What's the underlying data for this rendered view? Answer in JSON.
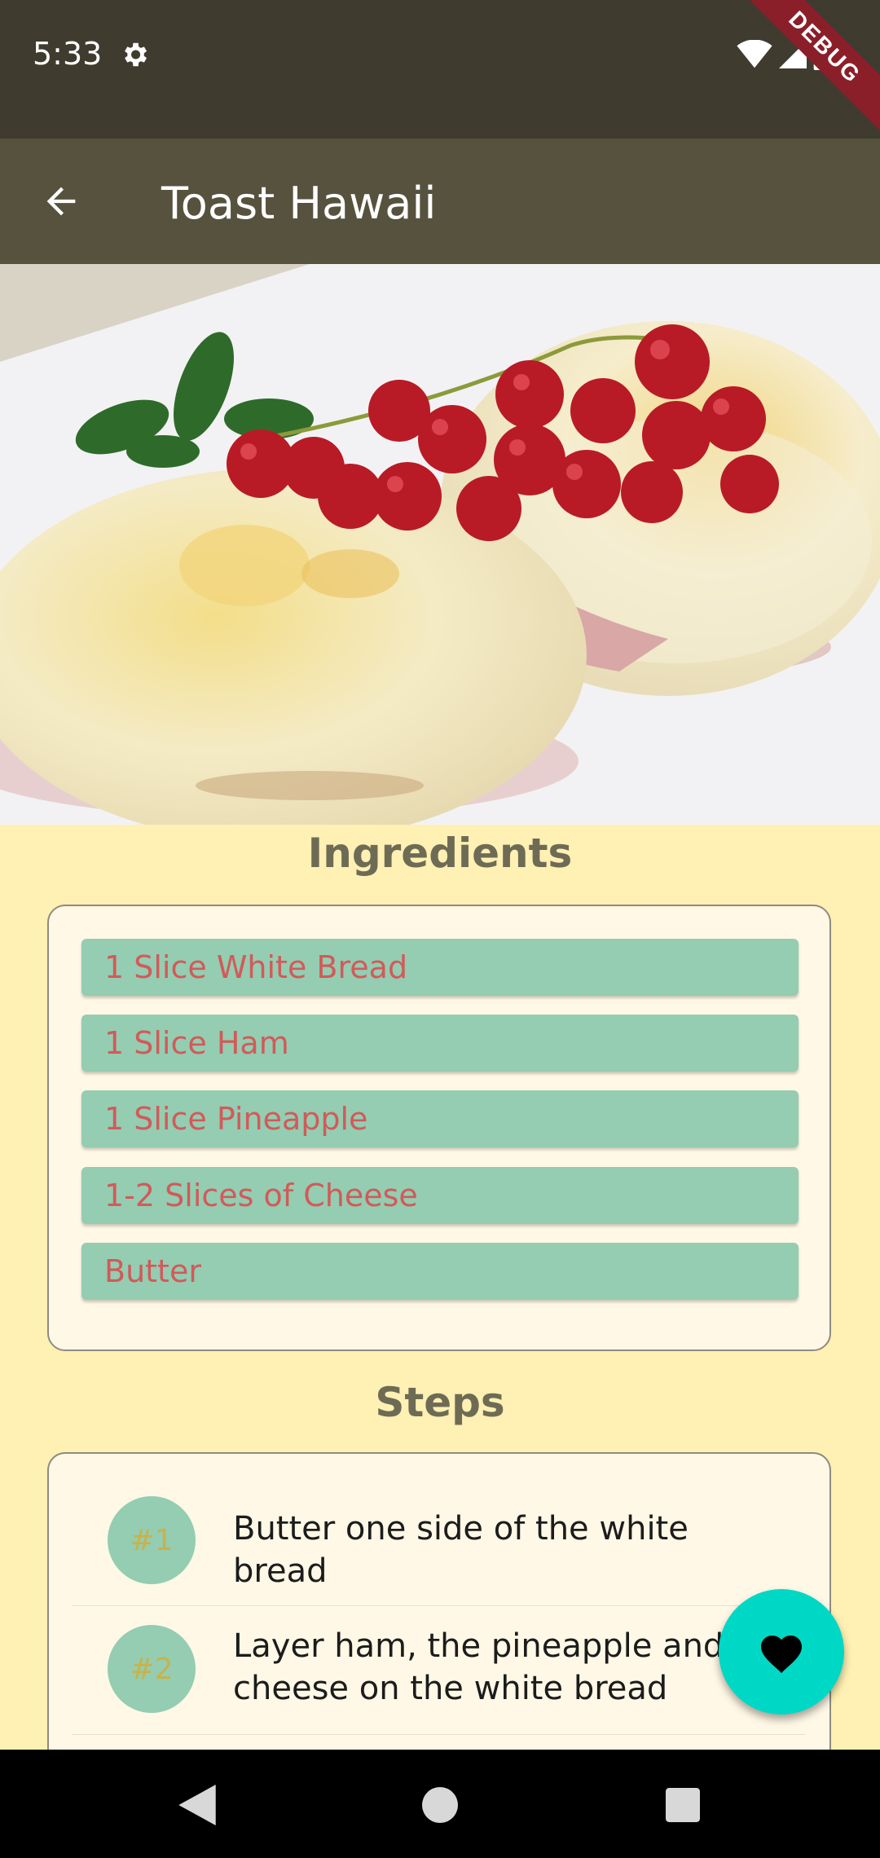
{
  "status_bar": {
    "time": "5:33",
    "debug_label": "DEBUG"
  },
  "app_bar": {
    "title": "Toast Hawaii"
  },
  "ingredients": {
    "heading": "Ingredients",
    "items": [
      "1 Slice White Bread",
      "1 Slice Ham",
      "1 Slice Pineapple",
      "1-2 Slices of Cheese",
      "Butter"
    ]
  },
  "steps": {
    "heading": "Steps",
    "items": [
      {
        "number": "#1",
        "text": "Butter one side of the white bread"
      },
      {
        "number": "#2",
        "text": "Layer ham, the pineapple and cheese on the white bread"
      }
    ]
  },
  "colors": {
    "app_bar": "#57523E",
    "background": "#FFF0B3",
    "ingredient_chip": "#94CDB1",
    "ingredient_text": "#D25A5A",
    "fab": "#00D8C6"
  },
  "icons": {
    "back": "arrow-back-icon",
    "fab": "heart-icon",
    "settings": "gear-icon"
  }
}
